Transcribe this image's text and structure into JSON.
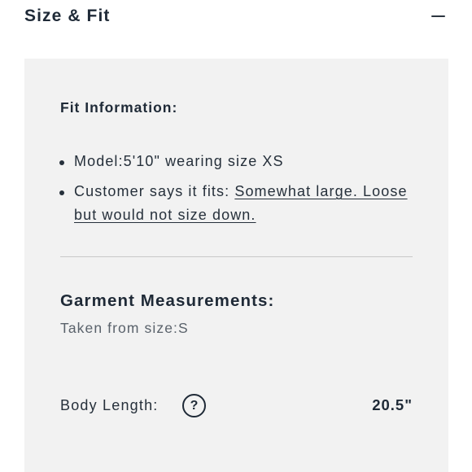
{
  "header": {
    "title": "Size & Fit",
    "toggle_icon": "minus-icon"
  },
  "fit_information": {
    "heading": "Fit Information:",
    "items": [
      {
        "text": "Model:5'10\" wearing size XS"
      },
      {
        "prefix": "Customer says it fits: ",
        "link": "Somewhat large. Loose but would not size down."
      }
    ]
  },
  "garment_measurements": {
    "heading": "Garment Measurements:",
    "subtitle": "Taken from size:S",
    "rows": [
      {
        "label": "Body Length:",
        "help_icon": "question-mark-icon",
        "help_symbol": "?",
        "value": "20.5\""
      }
    ]
  },
  "colors": {
    "text": "#1f2a37",
    "panel_background": "#f2f2f2",
    "divider": "#c8c8c8",
    "muted_text": "#5a626b"
  }
}
